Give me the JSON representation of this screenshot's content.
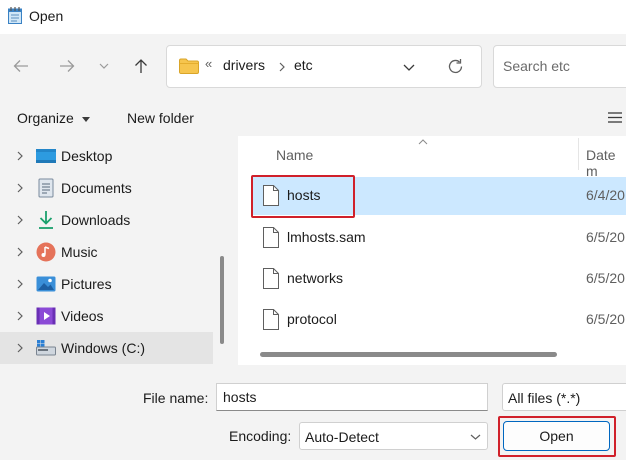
{
  "window": {
    "title": "Open"
  },
  "address": {
    "overflow_glyph": "«",
    "segments": [
      "drivers",
      "etc"
    ]
  },
  "search": {
    "placeholder": "Search etc"
  },
  "toolbar": {
    "organize_label": "Organize",
    "new_folder_label": "New folder"
  },
  "nav": {
    "items": [
      {
        "label": "Desktop",
        "icon": "desktop-icon"
      },
      {
        "label": "Documents",
        "icon": "documents-icon"
      },
      {
        "label": "Downloads",
        "icon": "download-icon"
      },
      {
        "label": "Music",
        "icon": "music-icon"
      },
      {
        "label": "Pictures",
        "icon": "pictures-icon"
      },
      {
        "label": "Videos",
        "icon": "videos-icon"
      },
      {
        "label": "Windows (C:)",
        "icon": "drive-icon",
        "selected": true
      }
    ]
  },
  "filelist": {
    "columns": {
      "name": "Name",
      "date": "Date m"
    },
    "files": [
      {
        "name": "hosts",
        "date": "6/4/20",
        "selected": true
      },
      {
        "name": "lmhosts.sam",
        "date": "6/5/20"
      },
      {
        "name": "networks",
        "date": "6/5/20"
      },
      {
        "name": "protocol",
        "date": "6/5/20"
      }
    ]
  },
  "bottom": {
    "filename_label": "File name:",
    "filename_value": "hosts",
    "filetype_value": "All files  (*.*)",
    "encoding_label": "Encoding:",
    "encoding_value": "Auto-Detect",
    "open_label": "Open"
  },
  "colors": {
    "accent": "#0067c0",
    "selection": "#cce8ff",
    "highlight_box": "#d0202a",
    "folder": "#f6c54e"
  }
}
